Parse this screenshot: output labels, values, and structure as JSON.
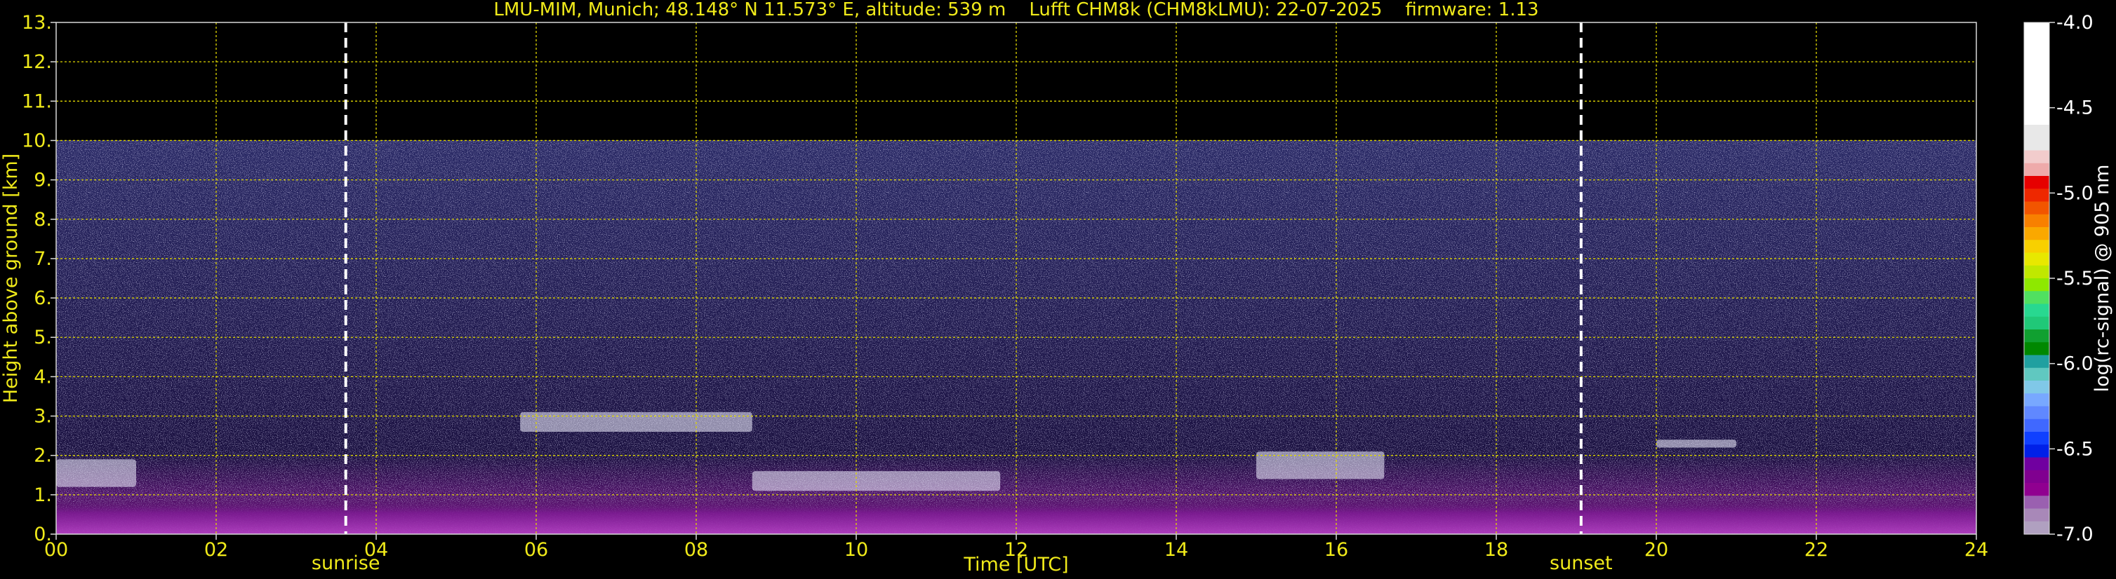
{
  "chart_data": {
    "type": "heatmap",
    "title": "LMU-MIM, Munich; 48.148° N 11.573° E, altitude: 539 m    Lufft CHM8k (CHM8kLMU): 22-07-2025    firmware: 1.13",
    "xlabel": "Time [UTC]",
    "ylabel": "Height above ground [km]",
    "xlim": [
      0,
      24
    ],
    "ylim": [
      0,
      13
    ],
    "x_ticks": [
      "00",
      "02",
      "04",
      "06",
      "08",
      "10",
      "12",
      "14",
      "16",
      "18",
      "20",
      "22",
      "24"
    ],
    "y_ticks": [
      "0.",
      "1.",
      "2.",
      "3.",
      "4.",
      "5.",
      "6.",
      "7.",
      "8.",
      "9.",
      "10.",
      "11.",
      "12.",
      "13."
    ],
    "grid": true,
    "signal_top_km": 10,
    "events": [
      {
        "label": "sunrise",
        "time": 3.62
      },
      {
        "label": "sunset",
        "time": 19.06
      }
    ],
    "colorbar": {
      "label": "log(rc-signal) @ 905 nm",
      "range": [
        -7.0,
        -4.0
      ],
      "ticks": [
        "-4.0",
        "-4.5",
        "-5.0",
        "-5.5",
        "-6.0",
        "-6.5",
        "-7.0"
      ],
      "colors": [
        "#ffffff",
        "#ffffff",
        "#ffffff",
        "#ffffff",
        "#ffffff",
        "#ffffff",
        "#ffffff",
        "#ffffff",
        "#e8e8e8",
        "#e8e8e8",
        "#f2cccc",
        "#eeaaaa",
        "#e60000",
        "#ee2800",
        "#f25500",
        "#f88000",
        "#faa800",
        "#f8d000",
        "#e8e800",
        "#c0e800",
        "#8ee800",
        "#50e060",
        "#28d890",
        "#20c878",
        "#10a030",
        "#008800",
        "#20a0a0",
        "#60c8c0",
        "#80c8e8",
        "#78a8ff",
        "#6088ff",
        "#4068ff",
        "#1040ff",
        "#0020e8",
        "#7000a0",
        "#800090",
        "#900090",
        "#9a60b0",
        "#a888b8",
        "#b0a0c0"
      ]
    },
    "features": [
      {
        "name": "boundary-layer-aerosol",
        "x": [
          0,
          24
        ],
        "y": [
          0,
          0.9
        ]
      },
      {
        "name": "cloud-layer-morning",
        "x": [
          0,
          1.0
        ],
        "y": [
          1.2,
          1.9
        ]
      },
      {
        "name": "cloud-layer-midday",
        "x": [
          5.8,
          8.7
        ],
        "y": [
          2.6,
          3.1
        ]
      },
      {
        "name": "cloud-layer-afternoon",
        "x": [
          8.7,
          11.8
        ],
        "y": [
          1.1,
          1.6
        ]
      },
      {
        "name": "cloud-layer-late",
        "x": [
          15.0,
          16.6
        ],
        "y": [
          1.4,
          2.1
        ]
      },
      {
        "name": "cloud-layer-evening",
        "x": [
          20.0,
          21.0
        ],
        "y": [
          2.2,
          2.4
        ]
      }
    ]
  }
}
